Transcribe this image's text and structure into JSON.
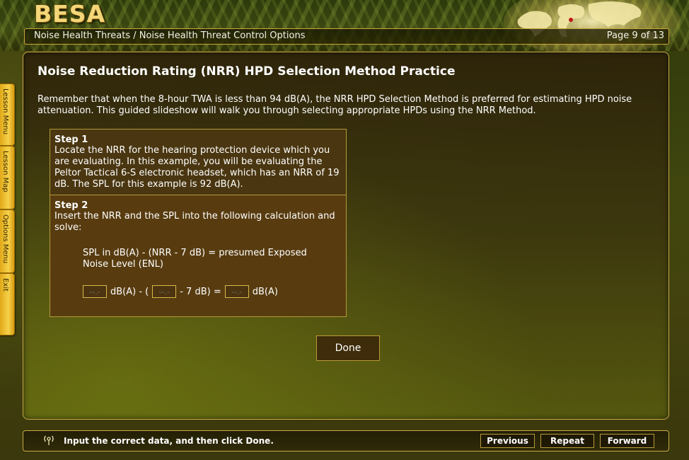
{
  "header": {
    "logo_text": "BESA",
    "breadcrumb": "Noise Health Threats / Noise Health Threat Control Options",
    "page_indicator": "Page 9 of 13"
  },
  "side_tabs": [
    {
      "label": "Lesson Menu"
    },
    {
      "label": "Lesson Map"
    },
    {
      "label": "Options Menu"
    },
    {
      "label": "Exit"
    }
  ],
  "content": {
    "title": "Noise Reduction Rating (NRR) HPD Selection Method Practice",
    "intro": "Remember that when the 8-hour TWA is less than 94 dB(A), the NRR HPD Selection Method is preferred for estimating HPD noise attenuation. This guided slideshow will walk you through selecting appropriate HPDs using the NRR Method.",
    "step1": {
      "label": "Step 1",
      "body": "Locate the NRR for the hearing protection device which you are evaluating.  In this example, you will be evaluating the Peltor Tactical 6-S electronic headset, which has an NRR of 19 dB.  The SPL for this example is 92 dB(A)."
    },
    "step2": {
      "label": "Step 2",
      "body": "Insert the NRR and the SPL into the following calculation and solve:",
      "formula": "SPL in dB(A) - (NRR - 7 dB) = presumed Exposed Noise Level (ENL)"
    },
    "calc": {
      "input_placeholder": "--.-",
      "text1": "dB(A) - (",
      "text2": "- 7 dB) =",
      "text3": "dB(A)"
    },
    "done_label": "Done"
  },
  "footer": {
    "instruction": "Input the correct data, and then click Done.",
    "previous_label": "Previous",
    "repeat_label": "Repeat",
    "forward_label": "Forward"
  },
  "colors": {
    "accent_gold": "#caa94a",
    "tab_gold": "#f7d24a",
    "panel_brown": "#583c10"
  }
}
